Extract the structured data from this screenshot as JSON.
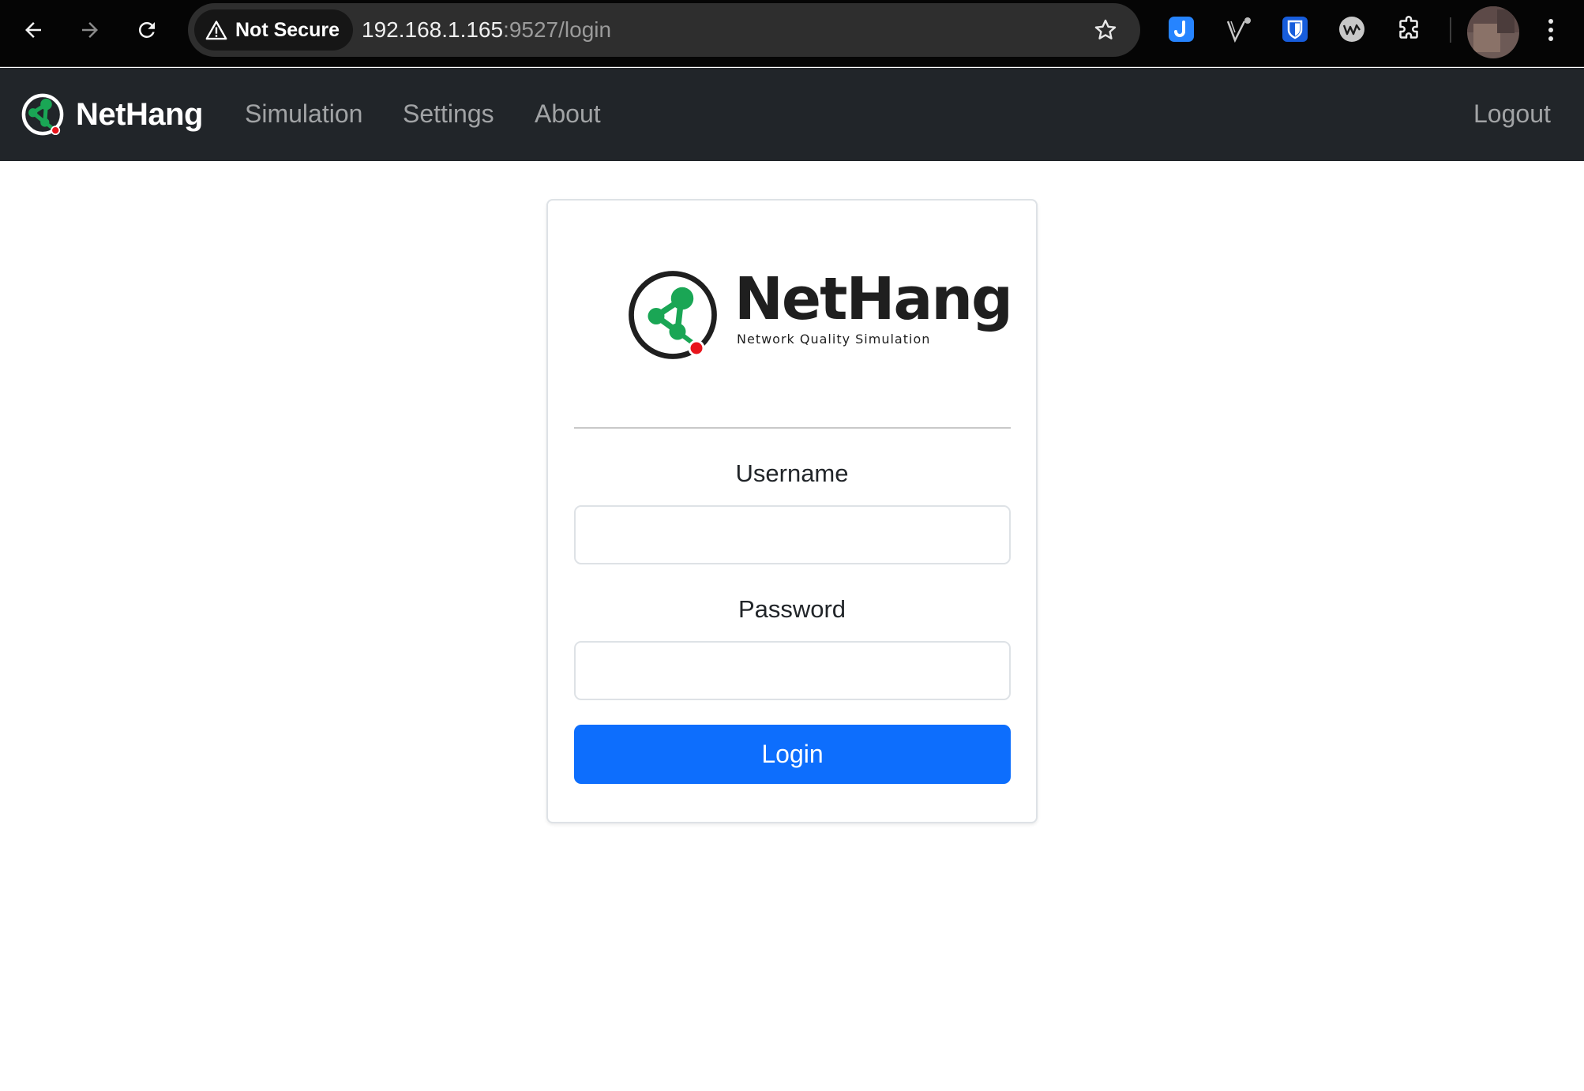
{
  "browser": {
    "security_label": "Not Secure",
    "url_host": "192.168.1.165",
    "url_rest": ":9527/login",
    "icons": {
      "back": "back-arrow-icon",
      "forward": "forward-arrow-icon",
      "reload": "reload-icon",
      "warning": "warning-icon",
      "bookmark": "star-icon",
      "extensions": [
        "jira-extension-icon",
        "vimium-extension-icon",
        "bitwarden-extension-icon",
        "wavebox-extension-icon",
        "puzzle-extensions-icon"
      ],
      "profile": "profile-avatar",
      "menu": "kebab-menu-icon"
    }
  },
  "navbar": {
    "brand": "NetHang",
    "links": [
      "Simulation",
      "Settings",
      "About"
    ],
    "logout": "Logout",
    "background": "#212529"
  },
  "login": {
    "logo_title": "NetHang",
    "logo_subtitle": "Network Quality Simulation",
    "username_label": "Username",
    "username_value": "",
    "password_label": "Password",
    "password_value": "",
    "submit_label": "Login",
    "accent": "#0d6efd"
  },
  "colors": {
    "logo_green": "#1aa655",
    "logo_red": "#e8141b"
  }
}
